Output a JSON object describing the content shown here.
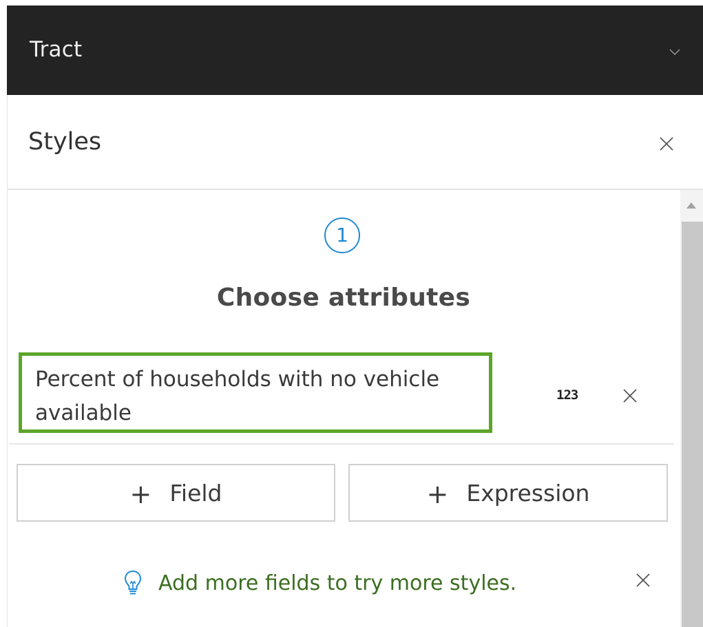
{
  "layer_bar": {
    "title": "Tract",
    "chevron_icon": "chevron-down-icon"
  },
  "styles_panel": {
    "title": "Styles",
    "close_icon": "close-icon"
  },
  "step": {
    "number": "1",
    "title": "Choose attributes"
  },
  "attribute": {
    "name": "Percent of households with no vehicle available",
    "type_badge": "123",
    "remove_icon": "close-icon"
  },
  "buttons": {
    "field_plus": "+",
    "field_label": "Field",
    "expression_plus": "+",
    "expression_label": "Expression"
  },
  "tip": {
    "icon": "lightbulb-icon",
    "text": "Add more fields to try more styles.",
    "dismiss_icon": "close-icon"
  },
  "colors": {
    "header_bg": "#232323",
    "accent_blue": "#1f8ad4",
    "highlight_green": "#5ca52a",
    "tip_text": "#3c6e22"
  }
}
